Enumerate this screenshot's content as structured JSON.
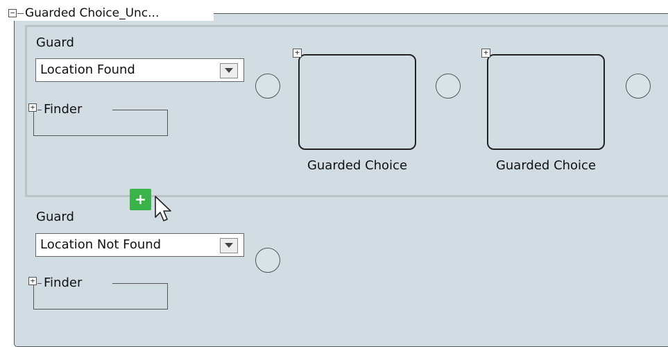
{
  "group": {
    "expander": "−",
    "title": "Guarded Choice_Unc..."
  },
  "branches": [
    {
      "guard_label": "Guard",
      "guard_value": "Location Found",
      "finder_expander": "+",
      "finder_label": "Finder",
      "choices": [
        {
          "expander": "+",
          "label": "Guarded Choice"
        },
        {
          "expander": "+",
          "label": "Guarded Choice"
        }
      ]
    },
    {
      "guard_label": "Guard",
      "guard_value": "Location Not Found",
      "finder_expander": "+",
      "finder_label": "Finder"
    }
  ],
  "add_button": {
    "label": "+",
    "color": "#3ab34a"
  },
  "colors": {
    "panel_bg": "#d1dde2",
    "branch_border": "#b9c2c4",
    "line": "#555555"
  },
  "icons": {
    "add": "plus-icon",
    "cursor": "mouse-pointer-icon",
    "collapse": "minus-square-icon",
    "expand": "plus-square-icon",
    "dropdown": "chevron-down-icon"
  }
}
